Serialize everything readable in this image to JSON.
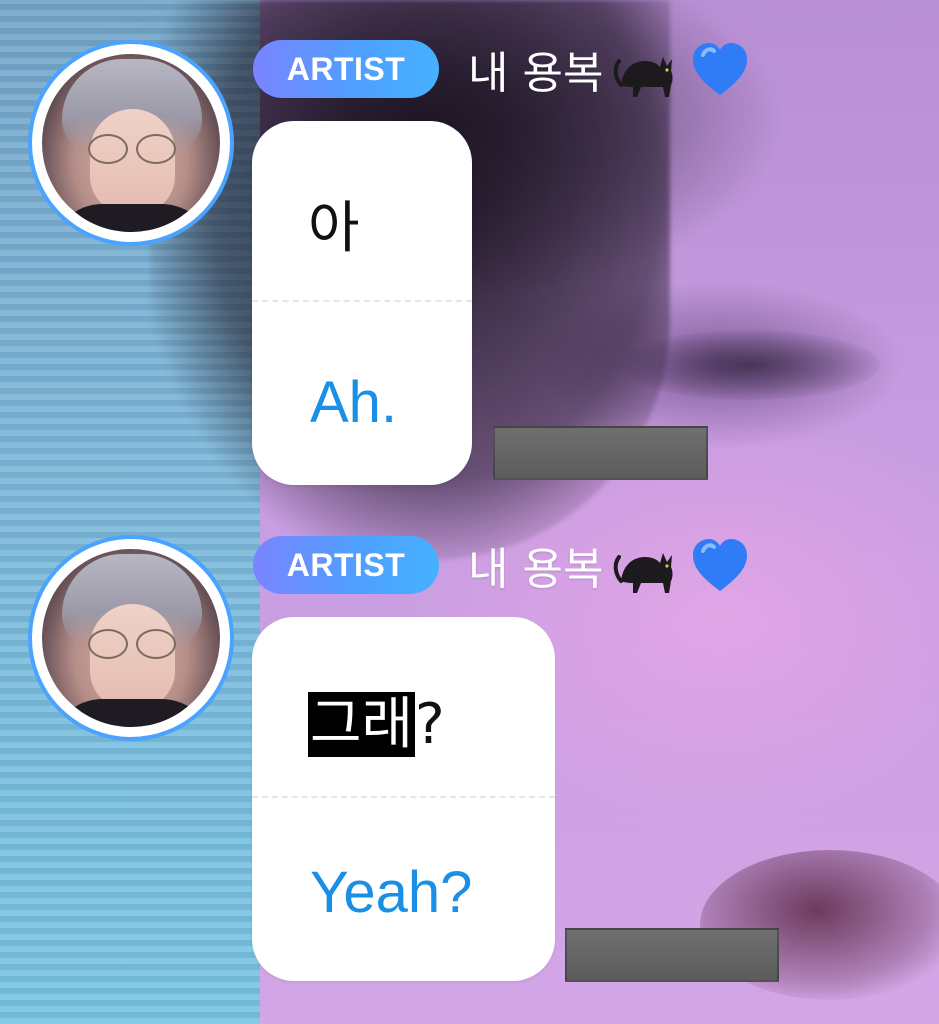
{
  "messages": [
    {
      "badge": "ARTIST",
      "name": "내 용복",
      "name_emojis": [
        "cat-icon",
        "blue-heart-icon"
      ],
      "korean": "아",
      "english": "Ah."
    },
    {
      "badge": "ARTIST",
      "name": "내 용복",
      "name_emojis": [
        "cat-icon",
        "blue-heart-icon"
      ],
      "korean_highlight": "그래",
      "korean_rest": "?",
      "english": "Yeah?"
    }
  ],
  "colors": {
    "badge_gradient_start": "#7a84ff",
    "badge_gradient_end": "#46b1ff",
    "avatar_ring": "#4aa3ff",
    "translation_text": "#1a8fe6",
    "bubble_bg": "#ffffff",
    "redaction": "#666666"
  }
}
